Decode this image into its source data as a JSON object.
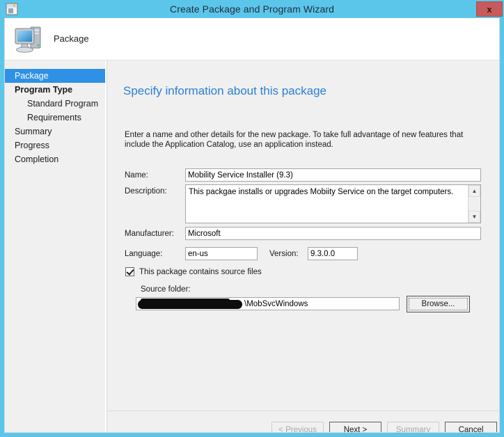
{
  "window": {
    "title": "Create Package and Program Wizard",
    "close_label": "x",
    "app_icon": "package-wizard-icon"
  },
  "banner": {
    "label": "Package",
    "icon": "computer-icon"
  },
  "sidebar": {
    "items": [
      {
        "label": "Package",
        "level": 0,
        "active": true,
        "bold": false
      },
      {
        "label": "Program Type",
        "level": 0,
        "active": false,
        "bold": true
      },
      {
        "label": "Standard Program",
        "level": 1,
        "active": false,
        "bold": false
      },
      {
        "label": "Requirements",
        "level": 1,
        "active": false,
        "bold": false
      },
      {
        "label": "Summary",
        "level": 0,
        "active": false,
        "bold": false
      },
      {
        "label": "Progress",
        "level": 0,
        "active": false,
        "bold": false
      },
      {
        "label": "Completion",
        "level": 0,
        "active": false,
        "bold": false
      }
    ]
  },
  "page": {
    "title": "Specify information about this package",
    "description": "Enter a name and other details for the new package. To take full advantage of new features that include the Application Catalog, use an application instead."
  },
  "form": {
    "name_label": "Name:",
    "name_value": "Mobility Service Installer (9.3)",
    "description_label": "Description:",
    "description_value": "This packgae installs or upgrades Mobiity Service on the target computers.",
    "manufacturer_label": "Manufacturer:",
    "manufacturer_value": "Microsoft",
    "language_label": "Language:",
    "language_value": "en-us",
    "version_label": "Version:",
    "version_value": "9.3.0.0",
    "source_checkbox_label": "This package contains source files",
    "source_checkbox_checked": true,
    "source_folder_label": "Source folder:",
    "source_folder_value": "\\MobSvcWindows",
    "source_folder_redacted": true,
    "browse_label": "Browse...",
    "scroll_up_icon": "chevron-up-icon",
    "scroll_down_icon": "chevron-down-icon"
  },
  "footer": {
    "previous_label": "< Previous",
    "previous_enabled": false,
    "next_label": "Next >",
    "next_enabled": true,
    "summary_label": "Summary",
    "summary_enabled": false,
    "cancel_label": "Cancel",
    "cancel_enabled": true
  },
  "colors": {
    "titlebar": "#5cc6ea",
    "accent_blue": "#2a7fd4",
    "selection": "#2f91e5",
    "close_button": "#c75b5b",
    "panel": "#f0f0f0"
  }
}
